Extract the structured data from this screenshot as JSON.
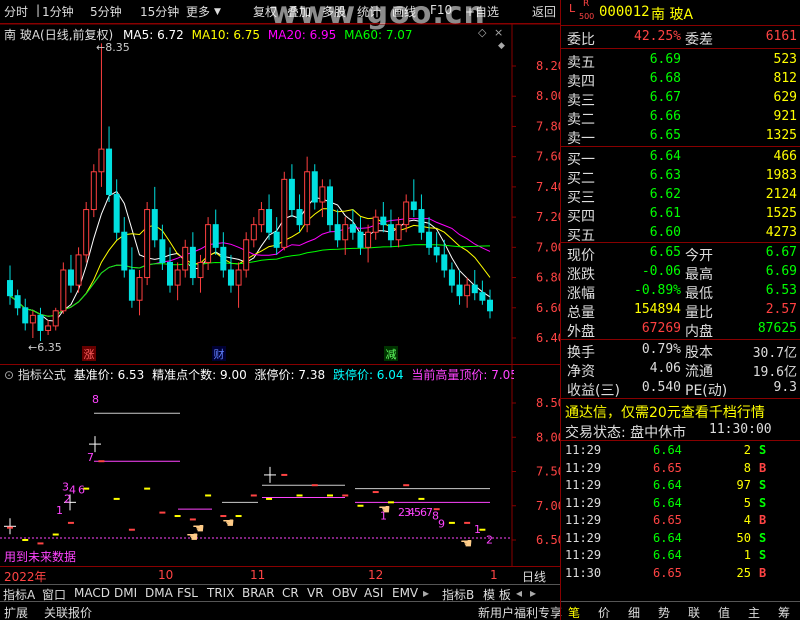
{
  "toolbar": {
    "items": [
      "分时",
      "1分钟",
      "5分钟",
      "15分钟",
      "更多",
      "复权",
      "叠加",
      "多股",
      "统计",
      "画线",
      "F10",
      "+自选",
      "返回"
    ]
  },
  "watermark": "www.goo.cn",
  "main_chart": {
    "title": "南 玻A(日线,前复权)",
    "ma": [
      {
        "label": "MA5: 6.72",
        "color": "#ffffff"
      },
      {
        "label": "MA10: 6.75",
        "color": "#ffff00"
      },
      {
        "label": "MA20: 6.95",
        "color": "#ff00ff"
      },
      {
        "label": "MA60: 7.07",
        "color": "#00ff00"
      }
    ],
    "high_label": "8.35",
    "low_label": "6.35",
    "events": [
      {
        "text": "涨",
        "color": "#ff4040"
      },
      {
        "text": "财",
        "color": "#4080ff"
      },
      {
        "text": "减",
        "color": "#40ff40"
      }
    ],
    "y_ticks": [
      "8.20",
      "8.00",
      "7.80",
      "7.60",
      "7.40",
      "7.20",
      "7.00",
      "6.80",
      "6.60",
      "6.40"
    ]
  },
  "indicator": {
    "name": "指标公式",
    "fields": [
      {
        "label": "基准价: 6.53",
        "color": "#ffffff"
      },
      {
        "label": "精准点个数: 9.00",
        "color": "#ffffff"
      },
      {
        "label": "涨停价: 7.38",
        "color": "#ffffff"
      },
      {
        "label": "跌停价: 6.04",
        "color": "#00ffff"
      },
      {
        "label": "当前高量顶价: 7.05",
        "color": "#ff40ff"
      },
      {
        "label": "当前",
        "color": "#ff40ff"
      }
    ],
    "y_ticks": [
      "8.50",
      "8.00",
      "7.50",
      "7.00",
      "6.50"
    ],
    "note": "用到未来数据",
    "num_labels": [
      "8",
      "7",
      "3",
      "4",
      "6",
      "2",
      "1",
      "1",
      "2",
      "3",
      "4",
      "5",
      "6",
      "7",
      "8",
      "9",
      "1",
      "2"
    ]
  },
  "x_axis": {
    "labels": [
      "2022年",
      "10",
      "11",
      "12",
      "1"
    ],
    "period": "日线"
  },
  "indicator_tabs": [
    "指标A",
    "窗口",
    "MACD",
    "DMI",
    "DMA",
    "FSL",
    "TRIX",
    "BRAR",
    "CR",
    "VR",
    "OBV",
    "ASI",
    "EMV",
    "指标B",
    "模 板"
  ],
  "bottom_tabs": [
    "扩展",
    "关联报价"
  ],
  "bottom_notice": "新用户福利专享",
  "bottom_icons": [
    "笔",
    "价",
    "细",
    "势",
    "联",
    "值",
    "主",
    "筹"
  ],
  "stock": {
    "code": "000012",
    "name": "南 玻A",
    "mark_top": "L",
    "mark_mid": "R",
    "mark_bot": "500"
  },
  "orderbook": {
    "weibi_label": "委比",
    "weibi": "42.25%",
    "weicha_label": "委差",
    "weicha": "6161",
    "sells": [
      {
        "label": "卖五",
        "price": "6.69",
        "vol": "523"
      },
      {
        "label": "卖四",
        "price": "6.68",
        "vol": "812"
      },
      {
        "label": "卖三",
        "price": "6.67",
        "vol": "629"
      },
      {
        "label": "卖二",
        "price": "6.66",
        "vol": "921"
      },
      {
        "label": "卖一",
        "price": "6.65",
        "vol": "1325"
      }
    ],
    "buys": [
      {
        "label": "买一",
        "price": "6.64",
        "vol": "466"
      },
      {
        "label": "买二",
        "price": "6.63",
        "vol": "1983"
      },
      {
        "label": "买三",
        "price": "6.62",
        "vol": "2124"
      },
      {
        "label": "买四",
        "price": "6.61",
        "vol": "1525"
      },
      {
        "label": "买五",
        "price": "6.60",
        "vol": "4273"
      }
    ]
  },
  "quote": [
    {
      "l1": "现价",
      "v1": "6.65",
      "c1": "#00ff00",
      "l2": "今开",
      "v2": "6.67",
      "c2": "#00ff00"
    },
    {
      "l1": "涨跌",
      "v1": "-0.06",
      "c1": "#00ff00",
      "l2": "最高",
      "v2": "6.69",
      "c2": "#00ff00"
    },
    {
      "l1": "涨幅",
      "v1": "-0.89%",
      "c1": "#00ff00",
      "l2": "最低",
      "v2": "6.53",
      "c2": "#00ff00"
    },
    {
      "l1": "总量",
      "v1": "154894",
      "c1": "#ffff00",
      "l2": "量比",
      "v2": "2.57",
      "c2": "#ff4040"
    },
    {
      "l1": "外盘",
      "v1": "67269",
      "c1": "#ff4040",
      "l2": "内盘",
      "v2": "87625",
      "c2": "#00ff00"
    }
  ],
  "quote2": [
    {
      "l1": "换手",
      "v1": "0.79%",
      "l2": "股本",
      "v2": "30.7亿"
    },
    {
      "l1": "净资",
      "v1": "4.06",
      "l2": "流通",
      "v2": "19.6亿"
    },
    {
      "l1": "收益(三)",
      "v1": "0.540",
      "l2": "PE(动)",
      "v2": "9.3"
    }
  ],
  "promo": "通达信，仅需20元查看千档行情",
  "trade_status": {
    "label": "交易状态: 盘中休市",
    "time": "11:30:00"
  },
  "ticks": [
    {
      "time": "11:29",
      "price": "6.64",
      "vol": "2",
      "side": "S"
    },
    {
      "time": "11:29",
      "price": "6.65",
      "vol": "8",
      "side": "B"
    },
    {
      "time": "11:29",
      "price": "6.64",
      "vol": "97",
      "side": "S"
    },
    {
      "time": "11:29",
      "price": "6.64",
      "vol": "5",
      "side": "S"
    },
    {
      "time": "11:29",
      "price": "6.65",
      "vol": "4",
      "side": "B"
    },
    {
      "time": "11:29",
      "price": "6.64",
      "vol": "50",
      "side": "S"
    },
    {
      "time": "11:29",
      "price": "6.64",
      "vol": "1",
      "side": "S"
    },
    {
      "time": "11:30",
      "price": "6.65",
      "vol": "25",
      "side": "B"
    }
  ],
  "colors": {
    "up": "#ff4040",
    "down": "#00e0e0",
    "grid": "#800000",
    "label": "#ff4040"
  },
  "chart_data": {
    "type": "candlestick",
    "title": "南 玻A(日线,前复权)",
    "ylim": [
      6.35,
      8.35
    ],
    "dates_axis": [
      "2022年",
      "10",
      "11",
      "12",
      "1"
    ],
    "ohlc": [
      [
        6.78,
        6.88,
        6.62,
        6.68
      ],
      [
        6.68,
        6.72,
        6.55,
        6.6
      ],
      [
        6.6,
        6.66,
        6.45,
        6.5
      ],
      [
        6.5,
        6.58,
        6.4,
        6.55
      ],
      [
        6.55,
        6.6,
        6.38,
        6.45
      ],
      [
        6.45,
        6.52,
        6.42,
        6.48
      ],
      [
        6.48,
        6.6,
        6.45,
        6.58
      ],
      [
        6.58,
        6.9,
        6.56,
        6.85
      ],
      [
        6.85,
        6.95,
        6.7,
        6.75
      ],
      [
        6.75,
        7.0,
        6.7,
        6.95
      ],
      [
        6.95,
        7.3,
        6.9,
        7.25
      ],
      [
        7.25,
        7.55,
        7.2,
        7.5
      ],
      [
        7.5,
        8.35,
        7.4,
        7.65
      ],
      [
        7.65,
        7.8,
        7.3,
        7.35
      ],
      [
        7.35,
        7.45,
        7.05,
        7.1
      ],
      [
        7.1,
        7.2,
        6.8,
        6.85
      ],
      [
        6.85,
        7.0,
        6.6,
        6.65
      ],
      [
        6.65,
        6.85,
        6.55,
        6.8
      ],
      [
        6.8,
        7.3,
        6.75,
        7.25
      ],
      [
        7.25,
        7.4,
        7.0,
        7.05
      ],
      [
        7.05,
        7.15,
        6.85,
        6.9
      ],
      [
        6.9,
        7.0,
        6.7,
        6.75
      ],
      [
        6.75,
        6.9,
        6.65,
        6.85
      ],
      [
        6.85,
        7.05,
        6.8,
        7.0
      ],
      [
        7.0,
        7.1,
        6.75,
        6.8
      ],
      [
        6.8,
        6.95,
        6.7,
        6.9
      ],
      [
        6.9,
        7.2,
        6.85,
        7.15
      ],
      [
        7.15,
        7.25,
        6.95,
        7.0
      ],
      [
        7.0,
        7.1,
        6.8,
        6.85
      ],
      [
        6.85,
        6.95,
        6.7,
        6.75
      ],
      [
        6.75,
        6.9,
        6.6,
        6.85
      ],
      [
        6.85,
        7.1,
        6.8,
        7.05
      ],
      [
        7.05,
        7.2,
        7.0,
        7.15
      ],
      [
        7.15,
        7.3,
        7.1,
        7.25
      ],
      [
        7.25,
        7.35,
        7.05,
        7.1
      ],
      [
        7.1,
        7.2,
        6.95,
        7.0
      ],
      [
        7.0,
        7.5,
        6.98,
        7.45
      ],
      [
        7.45,
        7.55,
        7.2,
        7.25
      ],
      [
        7.25,
        7.35,
        7.1,
        7.15
      ],
      [
        7.15,
        7.6,
        7.1,
        7.5
      ],
      [
        7.5,
        7.55,
        7.25,
        7.3
      ],
      [
        7.3,
        7.45,
        7.2,
        7.4
      ],
      [
        7.4,
        7.45,
        7.1,
        7.15
      ],
      [
        7.15,
        7.25,
        7.0,
        7.05
      ],
      [
        7.05,
        7.2,
        6.95,
        7.15
      ],
      [
        7.15,
        7.25,
        7.05,
        7.1
      ],
      [
        7.1,
        7.2,
        6.95,
        7.0
      ],
      [
        7.0,
        7.15,
        6.9,
        7.1
      ],
      [
        7.1,
        7.25,
        7.05,
        7.2
      ],
      [
        7.2,
        7.3,
        7.1,
        7.15
      ],
      [
        7.15,
        7.25,
        7.0,
        7.05
      ],
      [
        7.05,
        7.2,
        7.0,
        7.15
      ],
      [
        7.15,
        7.35,
        7.1,
        7.3
      ],
      [
        7.3,
        7.45,
        7.2,
        7.25
      ],
      [
        7.25,
        7.35,
        7.05,
        7.1
      ],
      [
        7.1,
        7.2,
        6.95,
        7.0
      ],
      [
        7.0,
        7.1,
        6.9,
        6.95
      ],
      [
        6.95,
        7.05,
        6.8,
        6.85
      ],
      [
        6.85,
        6.9,
        6.7,
        6.75
      ],
      [
        6.75,
        6.85,
        6.62,
        6.68
      ],
      [
        6.68,
        6.8,
        6.6,
        6.75
      ],
      [
        6.75,
        6.85,
        6.65,
        6.7
      ],
      [
        6.7,
        6.78,
        6.62,
        6.65
      ],
      [
        6.65,
        6.72,
        6.53,
        6.58
      ]
    ]
  }
}
